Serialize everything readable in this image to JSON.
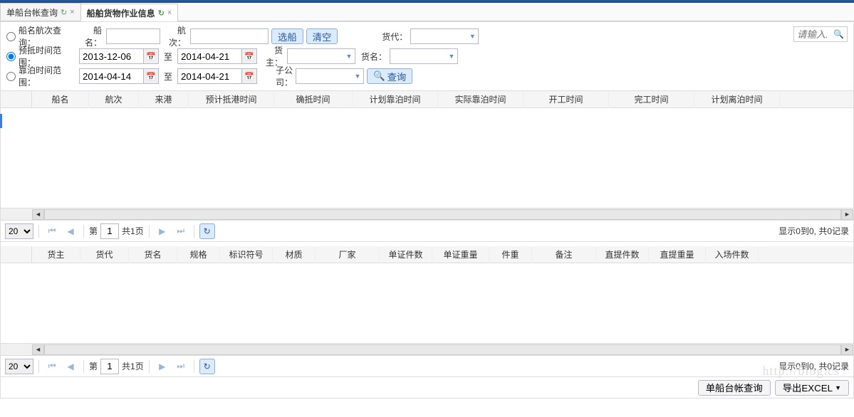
{
  "tabs": {
    "tab1": "单船台帐查询",
    "tab2": "船舶货物作业信息"
  },
  "search_placeholder": "请输入...",
  "filter": {
    "radio1_label": "船名航次查询：",
    "radio2_label": "预抵时间范围：",
    "radio3_label": "靠泊时间范围：",
    "ship_name_label": "船名：",
    "voyage_label": "航次：",
    "select_ship_btn": "选船",
    "clear_btn": "清空",
    "agent_label": "货代：",
    "to_label": "至",
    "owner_label": "货主：",
    "cargo_label": "货名：",
    "subsidiary_label": "子公司：",
    "query_btn": "查询",
    "date1_from": "2013-12-06",
    "date1_to": "2014-04-21",
    "date2_from": "2014-04-14",
    "date2_to": "2014-04-21"
  },
  "grid1_headers": [
    "船名",
    "航次",
    "来港",
    "预计抵港时间",
    "确抵时间",
    "计划靠泊时间",
    "实际靠泊时间",
    "开工时间",
    "完工时间",
    "计划离泊时间"
  ],
  "grid2_headers": [
    "货主",
    "货代",
    "货名",
    "规格",
    "标识符号",
    "材质",
    "厂家",
    "单证件数",
    "单证重量",
    "件重",
    "备注",
    "直提件数",
    "直提重量",
    "入场件数"
  ],
  "pager": {
    "size": "20",
    "page_prefix": "第",
    "page_value": "1",
    "page_suffix": "共1页",
    "status": "显示0到0, 共0记录"
  },
  "bottom": {
    "ledger_btn": "单船台帐查询",
    "export_btn": "导出EXCEL"
  },
  "watermark": "http://blog.cs",
  "grid1_widths": [
    80,
    70,
    70,
    120,
    110,
    120,
    120,
    120,
    120,
    120
  ],
  "grid2_widths": [
    68,
    68,
    68,
    60,
    74,
    60,
    90,
    74,
    80,
    60,
    90,
    74,
    80,
    74
  ]
}
